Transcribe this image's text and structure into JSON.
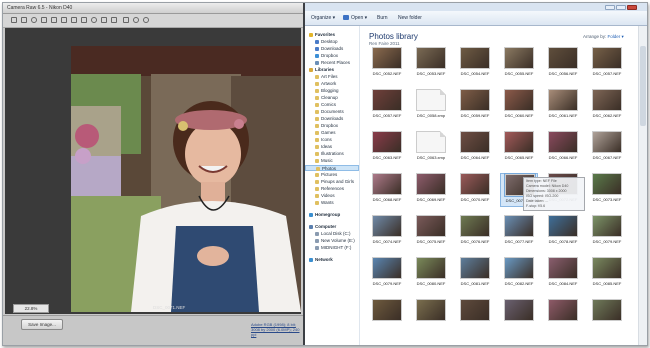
{
  "camera_raw": {
    "title": "Camera Raw 6.5 - Nikon D40",
    "zoom": "22.8%",
    "filename": "DSC_0071.NEF",
    "save_label": "Save Image...",
    "workflow_link": "Adobe RGB (1998); 8 bit; 3008 by 2000 (6.0MP); 240 ppi"
  },
  "explorer": {
    "toolbar": {
      "organize": "Organize ▾",
      "open": "Open ▾",
      "burn": "Burn",
      "new_folder": "New folder"
    },
    "library_title": "Photos library",
    "library_subtitle": "Ren Faire 2011",
    "arrange_label": "Arrange by:",
    "arrange_value": "Folder ▾",
    "nav": [
      {
        "label": "Favorites",
        "type": "head",
        "icon": "star-icon",
        "color": "#e3b52a"
      },
      {
        "label": "Desktop",
        "icon": "desktop-icon",
        "color": "#4a7bc8"
      },
      {
        "label": "Downloads",
        "icon": "downloads-icon",
        "color": "#4a7bc8"
      },
      {
        "label": "Dropbox",
        "icon": "dropbox-icon",
        "color": "#3d8fd6"
      },
      {
        "label": "Recent Places",
        "icon": "recent-places-icon",
        "color": "#6a8fb8"
      },
      {
        "label": "Libraries",
        "type": "head",
        "icon": "libraries-icon",
        "color": "#d9a93a"
      },
      {
        "label": "Art Files",
        "icon": "folder-icon",
        "color": "#e0c060"
      },
      {
        "label": "Artwork",
        "icon": "folder-icon",
        "color": "#e0c060"
      },
      {
        "label": "Blogging",
        "icon": "folder-icon",
        "color": "#e0c060"
      },
      {
        "label": "Cleanup",
        "icon": "folder-icon",
        "color": "#e0c060"
      },
      {
        "label": "Comics",
        "icon": "folder-icon",
        "color": "#e0c060"
      },
      {
        "label": "Documents",
        "icon": "documents-icon",
        "color": "#e0c060"
      },
      {
        "label": "Downloads",
        "icon": "folder-icon",
        "color": "#e0c060"
      },
      {
        "label": "Dropbox",
        "icon": "folder-icon",
        "color": "#e0c060"
      },
      {
        "label": "Games",
        "icon": "folder-icon",
        "color": "#e0c060"
      },
      {
        "label": "Icons",
        "icon": "folder-icon",
        "color": "#e0c060"
      },
      {
        "label": "Ideas",
        "icon": "folder-icon",
        "color": "#e0c060"
      },
      {
        "label": "Illustrations",
        "icon": "folder-icon",
        "color": "#e0c060"
      },
      {
        "label": "Music",
        "icon": "music-icon",
        "color": "#e0c060"
      },
      {
        "label": "Photos",
        "icon": "pictures-icon",
        "color": "#e0c060",
        "selected": true
      },
      {
        "label": "Pictures",
        "icon": "pictures-icon",
        "color": "#e0c060"
      },
      {
        "label": "Pinups and Girls",
        "icon": "folder-icon",
        "color": "#e0c060"
      },
      {
        "label": "References",
        "icon": "folder-icon",
        "color": "#e0c060"
      },
      {
        "label": "Videos",
        "icon": "videos-icon",
        "color": "#e0c060"
      },
      {
        "label": "Wants",
        "icon": "folder-icon",
        "color": "#e0c060"
      },
      {
        "label": "",
        "type": "gap"
      },
      {
        "label": "Homegroup",
        "type": "head",
        "icon": "homegroup-icon",
        "color": "#3b8fd0"
      },
      {
        "label": "",
        "type": "gap"
      },
      {
        "label": "Computer",
        "type": "head",
        "icon": "computer-icon",
        "color": "#5a7fae"
      },
      {
        "label": "Local Disk (C:)",
        "icon": "drive-icon",
        "color": "#8a9bb0"
      },
      {
        "label": "New Volume (E:)",
        "icon": "drive-icon",
        "color": "#8a9bb0"
      },
      {
        "label": "MIDNIGHT (F:)",
        "icon": "drive-icon",
        "color": "#8a9bb0"
      },
      {
        "label": "",
        "type": "gap"
      },
      {
        "label": "Network",
        "type": "head",
        "icon": "network-icon",
        "color": "#3b8fd0"
      }
    ],
    "files": [
      {
        "name": "DSC_0052.NEF",
        "c": "#8a6a4e"
      },
      {
        "name": "DSC_0053.NEF",
        "c": "#7a6a54"
      },
      {
        "name": "DSC_0054.NEF",
        "c": "#6e5b44"
      },
      {
        "name": "DSC_0055.NEF",
        "c": "#8b7a62"
      },
      {
        "name": "DSC_0056.NEF",
        "c": "#5f4e3c"
      },
      {
        "name": "DSC_0057.NEF",
        "c": "#766048"
      },
      {
        "name": "DSC_0057.NEF",
        "c": "#6f3f3a"
      },
      {
        "name": "DSC_0058.xmp",
        "c": "file"
      },
      {
        "name": "DSC_0059.NEF",
        "c": "#7e5d47"
      },
      {
        "name": "DSC_0060.NEF",
        "c": "#8c5a4a"
      },
      {
        "name": "DSC_0061.NEF",
        "c": "#a88d79"
      },
      {
        "name": "DSC_0062.NEF",
        "c": "#7e6656"
      },
      {
        "name": "DSC_0063.NEF",
        "c": "#8a3c4a"
      },
      {
        "name": "DSC_0063.xmp",
        "c": "file"
      },
      {
        "name": "DSC_0064.NEF",
        "c": "#6e4e44"
      },
      {
        "name": "DSC_0065.NEF",
        "c": "#a35a5a"
      },
      {
        "name": "DSC_0066.NEF",
        "c": "#8a4a5e"
      },
      {
        "name": "DSC_0067.NEF",
        "c": "#b0a39a"
      },
      {
        "name": "DSC_0068.NEF",
        "c": "#ad7a8a"
      },
      {
        "name": "DSC_0069.NEF",
        "c": "#8e5c6c"
      },
      {
        "name": "DSC_0070.NEF",
        "c": "#9a5a5a"
      },
      {
        "name": "DSC_0071.NEF",
        "c": "#7e6c6c",
        "selected": true
      },
      {
        "name": "DSC_0072.NEF",
        "c": "#6a4a4a"
      },
      {
        "name": "DSC_0073.NEF",
        "c": "#5a7a4a"
      },
      {
        "name": "DSC_0074.NEF",
        "c": "#6f8aa8"
      },
      {
        "name": "DSC_0075.NEF",
        "c": "#7a5a5a"
      },
      {
        "name": "DSC_0076.NEF",
        "c": "#6e7a52"
      },
      {
        "name": "DSC_0077.NEF",
        "c": "#6a8fb5"
      },
      {
        "name": "DSC_0078.NEF",
        "c": "#3f6f9a"
      },
      {
        "name": "DSC_0079.NEF",
        "c": "#7c9468"
      },
      {
        "name": "DSC_0079.NEF",
        "c": "#5a86b2"
      },
      {
        "name": "DSC_0080.NEF",
        "c": "#7a8a5a"
      },
      {
        "name": "DSC_0081.NEF",
        "c": "#5e7e9c"
      },
      {
        "name": "DSC_0082.NEF",
        "c": "#6a9ac4"
      },
      {
        "name": "DSC_0084.NEF",
        "c": "#8a5e6e"
      },
      {
        "name": "DSC_0085.NEF",
        "c": "#7a8a60"
      },
      {
        "name": "",
        "c": "#6e5a3e"
      },
      {
        "name": "",
        "c": "#7a6e4e"
      },
      {
        "name": "",
        "c": "#5e4a3c"
      },
      {
        "name": "",
        "c": "#6a6070"
      },
      {
        "name": "",
        "c": "#8e5a68"
      },
      {
        "name": "",
        "c": "#6f7a5a"
      }
    ],
    "tooltip": "Item type: NEF File\nCamera model: Nikon D40\nDimensions: 3008 x 2000\nISO speed: ISO-200\nDate taken: ...\nF-stop: f/5.6"
  }
}
